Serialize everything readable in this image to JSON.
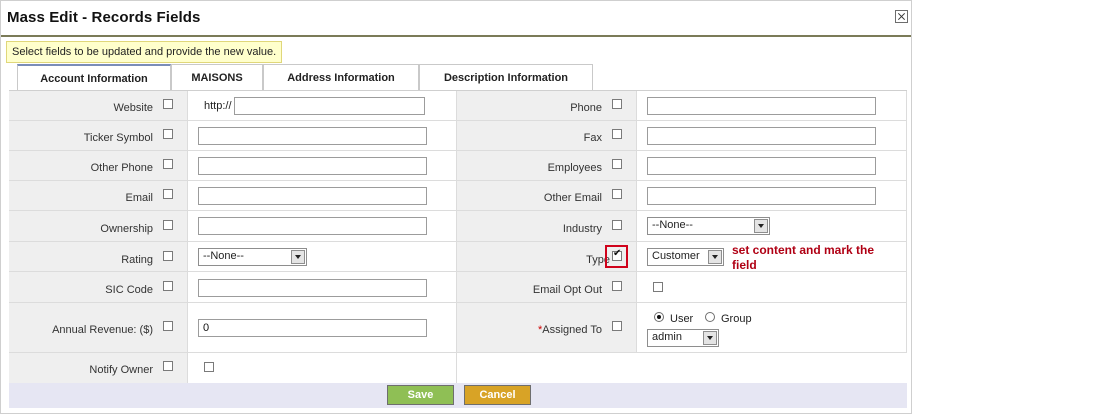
{
  "dialog": {
    "title": "Mass Edit - Records Fields",
    "hint": "Select fields to be updated and provide the new value."
  },
  "tabs": [
    {
      "label": "Account Information",
      "active": true
    },
    {
      "label": "MAISONS",
      "active": false
    },
    {
      "label": "Address Information",
      "active": false
    },
    {
      "label": "Description Information",
      "active": false
    }
  ],
  "left_fields": [
    {
      "label": "Website",
      "prefix": "http://",
      "value": ""
    },
    {
      "label": "Ticker Symbol",
      "value": ""
    },
    {
      "label": "Other Phone",
      "value": ""
    },
    {
      "label": "Email",
      "value": ""
    },
    {
      "label": "Ownership",
      "value": ""
    },
    {
      "label": "Rating",
      "select": "--None--"
    },
    {
      "label": "SIC Code",
      "value": ""
    },
    {
      "label": "Annual Revenue: ($)",
      "value": "0"
    },
    {
      "label": "Notify Owner"
    }
  ],
  "right_fields": [
    {
      "label": "Phone",
      "value": ""
    },
    {
      "label": "Fax",
      "value": ""
    },
    {
      "label": "Employees",
      "value": ""
    },
    {
      "label": "Other Email",
      "value": ""
    },
    {
      "label": "Industry",
      "select": "--None--"
    },
    {
      "label": "Type",
      "select": "Customer",
      "checked": true
    },
    {
      "label": "Email Opt Out"
    },
    {
      "label": "Assigned To",
      "required_mark": "*",
      "radio_user": "User",
      "radio_group": "Group",
      "select": "admin"
    }
  ],
  "annotation": {
    "line1": "set content and mark the",
    "line2": "field",
    "color": "#b00014"
  },
  "footer": {
    "save_label": "Save",
    "cancel_label": "Cancel"
  }
}
